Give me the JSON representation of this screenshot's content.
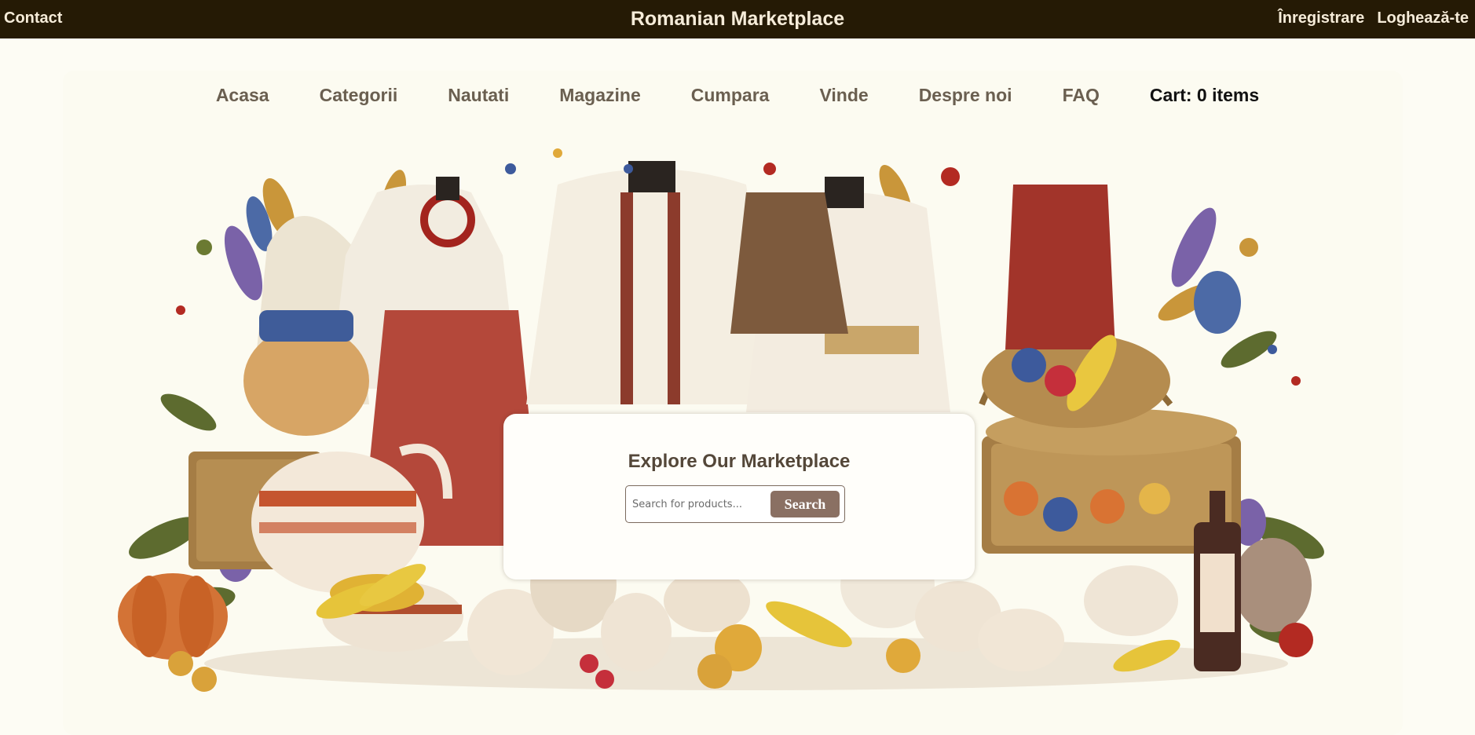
{
  "header": {
    "contact_label": "Contact",
    "site_title": "Romanian Marketplace",
    "register_label": "Înregistrare",
    "login_label": "Loghează-te"
  },
  "nav": {
    "items": [
      "Acasa",
      "Categorii",
      "Nautati",
      "Magazine",
      "Cumpara",
      "Vinde",
      "Despre noi",
      "FAQ"
    ],
    "cart_label": "Cart: 0 items"
  },
  "search": {
    "title": "Explore Our Marketplace",
    "placeholder": "Search for products...",
    "button_label": "Search"
  },
  "colors": {
    "header_bg": "#251a05",
    "page_bg": "#fdfcf4",
    "nav_text": "#6a5f50",
    "button_bg": "#8a7063"
  }
}
